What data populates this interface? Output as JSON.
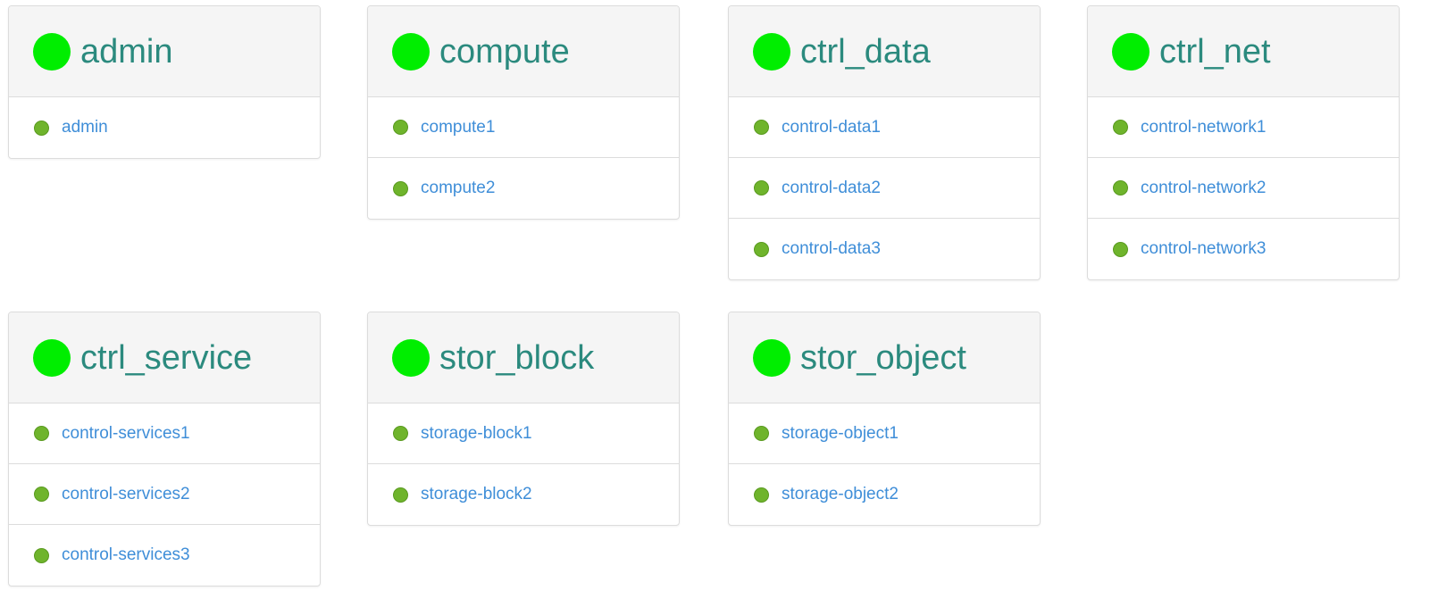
{
  "colors": {
    "status_ok": "#00ee00",
    "node_ok": "#6fb42c",
    "title": "#2b8a7e",
    "link": "#3f8ed8"
  },
  "groups": [
    {
      "id": "admin",
      "title": "admin",
      "status_icon": "status-dot-icon",
      "nodes": [
        "admin"
      ]
    },
    {
      "id": "compute",
      "title": "compute",
      "status_icon": "status-dot-icon",
      "nodes": [
        "compute1",
        "compute2"
      ]
    },
    {
      "id": "ctrl_data",
      "title": "ctrl_data",
      "status_icon": "status-dot-icon",
      "nodes": [
        "control-data1",
        "control-data2",
        "control-data3"
      ]
    },
    {
      "id": "ctrl_net",
      "title": "ctrl_net",
      "status_icon": "status-dot-icon",
      "nodes": [
        "control-network1",
        "control-network2",
        "control-network3"
      ]
    },
    {
      "id": "ctrl_service",
      "title": "ctrl_service",
      "status_icon": "status-dot-icon",
      "nodes": [
        "control-services1",
        "control-services2",
        "control-services3"
      ]
    },
    {
      "id": "stor_block",
      "title": "stor_block",
      "status_icon": "status-dot-icon",
      "nodes": [
        "storage-block1",
        "storage-block2"
      ]
    },
    {
      "id": "stor_object",
      "title": "stor_object",
      "status_icon": "status-dot-icon",
      "nodes": [
        "storage-object1",
        "storage-object2"
      ]
    }
  ]
}
